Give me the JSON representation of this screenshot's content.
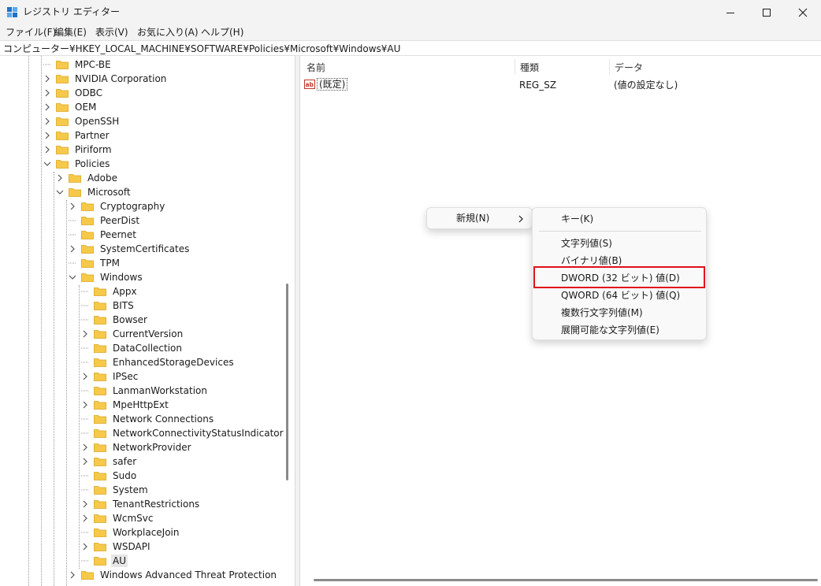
{
  "window": {
    "title": "レジストリ エディター",
    "controls": {
      "minimize": "minimize-icon",
      "maximize": "maximize-icon",
      "close": "close-icon"
    }
  },
  "menubar": [
    {
      "label": "ファイル(F)"
    },
    {
      "label": "編集(E)"
    },
    {
      "label": "表示(V)"
    },
    {
      "label": "お気に入り(A)"
    },
    {
      "label": "ヘルプ(H)"
    }
  ],
  "address": "コンピューター¥HKEY_LOCAL_MACHINE¥SOFTWARE¥Policies¥Microsoft¥Windows¥AU",
  "tree": [
    {
      "label": "MPC-BE",
      "expander": "none"
    },
    {
      "label": "NVIDIA Corporation",
      "expander": "collapsed"
    },
    {
      "label": "ODBC",
      "expander": "collapsed"
    },
    {
      "label": "OEM",
      "expander": "collapsed"
    },
    {
      "label": "OpenSSH",
      "expander": "collapsed"
    },
    {
      "label": "Partner",
      "expander": "collapsed"
    },
    {
      "label": "Piriform",
      "expander": "collapsed"
    },
    {
      "label": "Policies",
      "expander": "expanded"
    },
    {
      "label": "Adobe",
      "expander": "collapsed"
    },
    {
      "label": "Microsoft",
      "expander": "expanded"
    },
    {
      "label": "Cryptography",
      "expander": "collapsed"
    },
    {
      "label": "PeerDist",
      "expander": "none"
    },
    {
      "label": "Peernet",
      "expander": "none"
    },
    {
      "label": "SystemCertificates",
      "expander": "collapsed"
    },
    {
      "label": "TPM",
      "expander": "none"
    },
    {
      "label": "Windows",
      "expander": "expanded"
    },
    {
      "label": "Appx",
      "expander": "none"
    },
    {
      "label": "BITS",
      "expander": "none"
    },
    {
      "label": "Bowser",
      "expander": "none"
    },
    {
      "label": "CurrentVersion",
      "expander": "collapsed"
    },
    {
      "label": "DataCollection",
      "expander": "none"
    },
    {
      "label": "EnhancedStorageDevices",
      "expander": "none"
    },
    {
      "label": "IPSec",
      "expander": "collapsed"
    },
    {
      "label": "LanmanWorkstation",
      "expander": "none"
    },
    {
      "label": "MpeHttpExt",
      "expander": "collapsed"
    },
    {
      "label": "Network Connections",
      "expander": "none"
    },
    {
      "label": "NetworkConnectivityStatusIndicator",
      "expander": "none"
    },
    {
      "label": "NetworkProvider",
      "expander": "collapsed"
    },
    {
      "label": "safer",
      "expander": "collapsed"
    },
    {
      "label": "Sudo",
      "expander": "none"
    },
    {
      "label": "System",
      "expander": "none"
    },
    {
      "label": "TenantRestrictions",
      "expander": "collapsed"
    },
    {
      "label": "WcmSvc",
      "expander": "collapsed"
    },
    {
      "label": "WorkplaceJoin",
      "expander": "none"
    },
    {
      "label": "WSDAPI",
      "expander": "collapsed"
    },
    {
      "label": "AU",
      "expander": "none",
      "selected": true
    },
    {
      "label": "Windows Advanced Threat Protection",
      "expander": "collapsed"
    }
  ],
  "list": {
    "columns": {
      "name": "名前",
      "type": "種類",
      "data": "データ"
    },
    "rows": [
      {
        "name": "(既定)",
        "type": "REG_SZ",
        "data": "(値の設定なし)",
        "icon": "string-value-icon"
      }
    ]
  },
  "context_menu": {
    "new_label": "新規(N)",
    "submenu": {
      "key": "キー(K)",
      "items": [
        "文字列値(S)",
        "バイナリ値(B)",
        "DWORD (32 ビット) 値(D)",
        "QWORD (64 ビット) 値(Q)",
        "複数行文字列値(M)",
        "展開可能な文字列値(E)"
      ],
      "highlighted": "DWORD (32 ビット) 値(D)"
    }
  },
  "colors": {
    "folder": "#f6c94a",
    "highlight_box": "#e0101a",
    "accent": "#0067c0"
  }
}
